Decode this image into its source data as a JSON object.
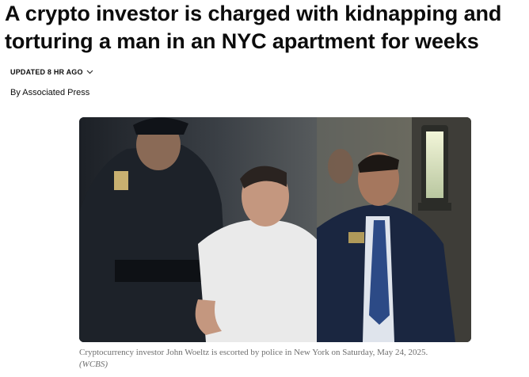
{
  "article": {
    "headline": "A crypto investor is charged with kidnapping and torturing a man in an NYC apartment for weeks",
    "updated_label": "UPDATED 8 HR AGO",
    "byline": "By Associated Press"
  },
  "media": {
    "photo_alt": "Cryptocurrency investor John Woeltz is escorted by police in New York on Saturday, May 24, 2025.",
    "caption": "Cryptocurrency investor John Woeltz is escorted by police in New York on Saturday, May 24, 2025.",
    "credit": "(WCBS)"
  },
  "icons": {
    "updated_toggle": "chevron-down-icon"
  }
}
